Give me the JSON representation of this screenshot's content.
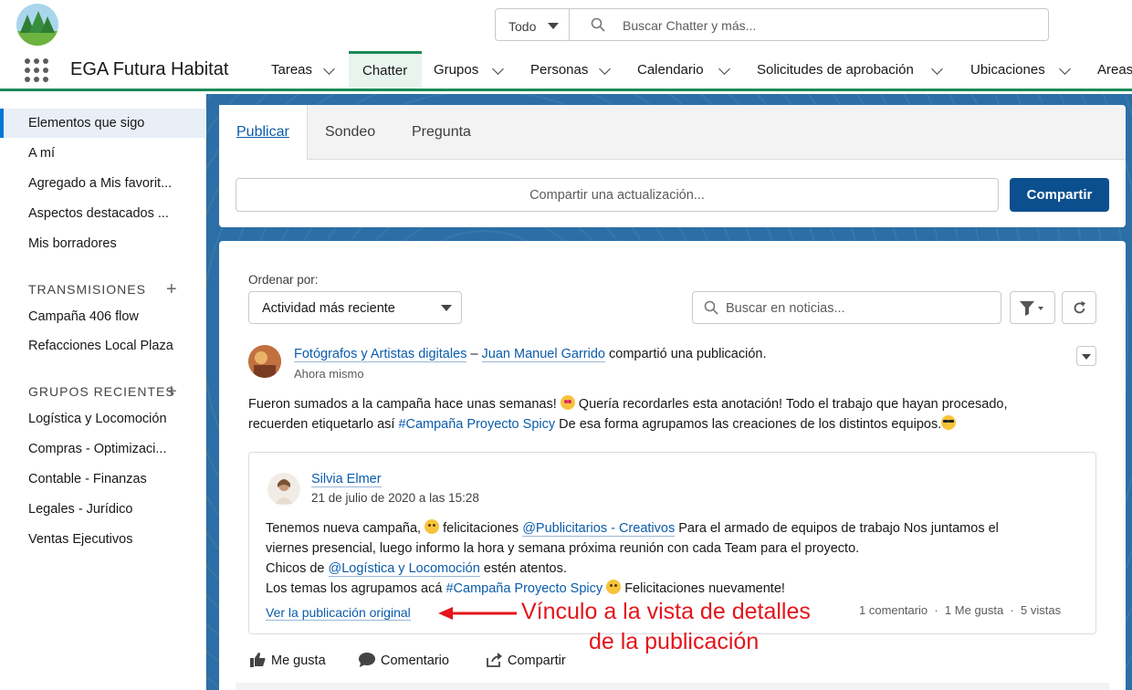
{
  "header": {
    "scope_label": "Todo",
    "search_placeholder": "Buscar Chatter y más..."
  },
  "nav": {
    "app_name": "EGA Futura Habitat",
    "items": [
      {
        "label": "Tareas"
      },
      {
        "label": "Chatter"
      },
      {
        "label": "Grupos"
      },
      {
        "label": "Personas"
      },
      {
        "label": "Calendario"
      },
      {
        "label": "Solicitudes de aprobación"
      },
      {
        "label": "Ubicaciones"
      },
      {
        "label": "Areas"
      }
    ]
  },
  "sidebar": {
    "items": [
      {
        "label": "Elementos que sigo"
      },
      {
        "label": "A mí"
      },
      {
        "label": "Agregado a Mis favorit..."
      },
      {
        "label": "Aspectos destacados ..."
      },
      {
        "label": "Mis borradores"
      }
    ],
    "streams_heading": "TRANSMISIONES",
    "streams": [
      {
        "label": "Campaña 406 flow"
      },
      {
        "label": "Refacciones Local Plaza"
      }
    ],
    "groups_heading": "GRUPOS RECIENTES",
    "groups": [
      {
        "label": "Logística y Locomoción"
      },
      {
        "label": "Compras - Optimizaci..."
      },
      {
        "label": "Contable - Finanzas"
      },
      {
        "label": "Legales - Jurídico"
      },
      {
        "label": "Ventas Ejecutivos"
      }
    ]
  },
  "publisher": {
    "tabs": [
      {
        "label": "Publicar"
      },
      {
        "label": "Sondeo"
      },
      {
        "label": "Pregunta"
      }
    ],
    "input_placeholder": "Compartir una actualización...",
    "share_button": "Compartir"
  },
  "feed": {
    "sort_label": "Ordenar por:",
    "sort_value": "Actividad más reciente",
    "search_placeholder": "Buscar en noticias...",
    "post": {
      "group": "Fotógrafos y Artistas digitales",
      "separator": "–",
      "author": "Juan Manuel Garrido",
      "action": "compartió una publicación.",
      "time": "Ahora mismo",
      "body_line1_a": "Fueron sumados a la campaña hace unas semanas!",
      "body_line1_b": "Quería recordarles esta anotación! Todo el trabajo que hayan procesado,",
      "body_line2_a": "recuerden etiquetarlo así",
      "body_line2_tag": "#Campaña Proyecto Spicy",
      "body_line2_b": "De esa forma agrupamos las creaciones de los distintos equipos.",
      "shared": {
        "author": "Silvia Elmer",
        "date": "21 de julio de 2020 a las 15:28",
        "line1_a": "Tenemos nueva campaña,",
        "line1_b": "felicitaciones",
        "line1_mention": "@Publicitarios - Creativos",
        "line1_c": "Para el armado de equipos de trabajo Nos juntamos el",
        "line2": "viernes presencial, luego informo la hora y semana próxima reunión con cada Team para el proyecto.",
        "line3_a": "Chicos de",
        "line3_mention": "@Logística y Locomoción",
        "line3_b": "estén atentos.",
        "line4_a": "Los temas los agrupamos acá",
        "line4_tag": "#Campaña Proyecto Spicy",
        "line4_b": "Felicitaciones nuevamente!",
        "view_original": "Ver la publicación original",
        "stats": "1 comentario  ·  1 Me gusta  ·  5 vistas"
      },
      "actions": [
        {
          "label": "Me gusta",
          "icon": "thumbs-up-icon"
        },
        {
          "label": "Comentario",
          "icon": "comment-icon"
        },
        {
          "label": "Compartir",
          "icon": "share-icon"
        }
      ]
    }
  },
  "annotation": {
    "line1": "Vínculo a la vista de detalles",
    "line2": "de la publicación",
    "color": "#e3151b"
  }
}
